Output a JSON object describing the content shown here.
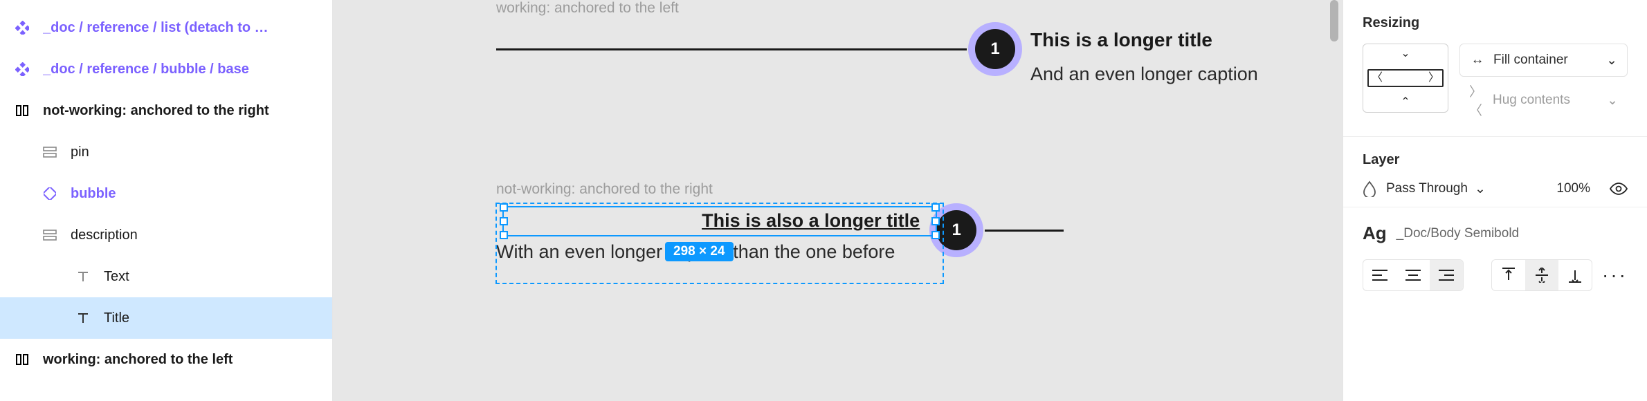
{
  "layers": {
    "comp_list": "_doc / reference / list  (detach to …",
    "comp_bubble": "_doc / reference / bubble / base",
    "not_working": "not-working: anchored to the right",
    "pin": "pin",
    "bubble": "bubble",
    "description": "description",
    "text": "Text",
    "title": "Title",
    "working": "working: anchored to the left"
  },
  "canvas": {
    "working": {
      "frame_label": "working: anchored to the left",
      "badge_num": "1",
      "title": "This is a longer title",
      "caption": "And an even longer caption"
    },
    "not_working": {
      "frame_label": "not-working: anchored to the right",
      "badge_num": "1",
      "title": "This is also a longer title",
      "caption": "With an even longer caption than the one before"
    },
    "selection_dims": "298 × 24"
  },
  "design": {
    "resizing": {
      "title": "Resizing",
      "fill": "Fill container",
      "hug": "Hug contents"
    },
    "layer": {
      "title": "Layer",
      "blend": "Pass Through",
      "opacity": "100%"
    },
    "typography": {
      "ag": "Ag",
      "style": "_Doc/Body Semibold"
    }
  }
}
